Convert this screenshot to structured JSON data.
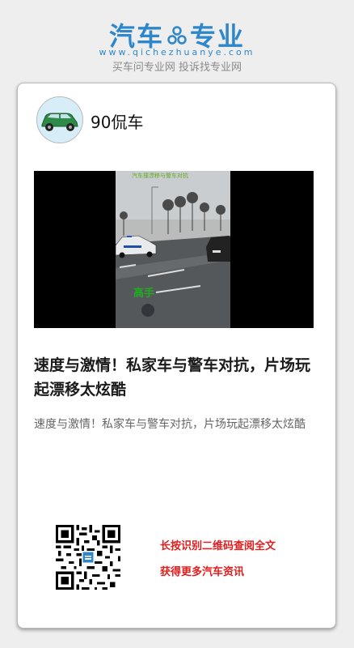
{
  "brand": {
    "left": "汽车",
    "right": "专业",
    "url": "www.qichezhuanye.com",
    "slogan": "买车问专业网 投诉找专业网",
    "color": "#2f87c9"
  },
  "post": {
    "author": "90侃车",
    "avatar_icon": "car-avatar-icon",
    "video": {
      "caption": "汽车撞漂移与警车对抗",
      "watermark": "高手"
    },
    "headline": "速度与激情！私家车与警车对抗，片场玩起漂移太炫酷",
    "summary": "速度与激情！私家车与警车对抗，片场玩起漂移太炫酷"
  },
  "footer": {
    "qr_icon": "qr-code-icon",
    "cta_line1": "长按识别二维码查阅全文",
    "cta_line2": "获得更多汽车资讯",
    "cta_color": "#e11d1d"
  }
}
